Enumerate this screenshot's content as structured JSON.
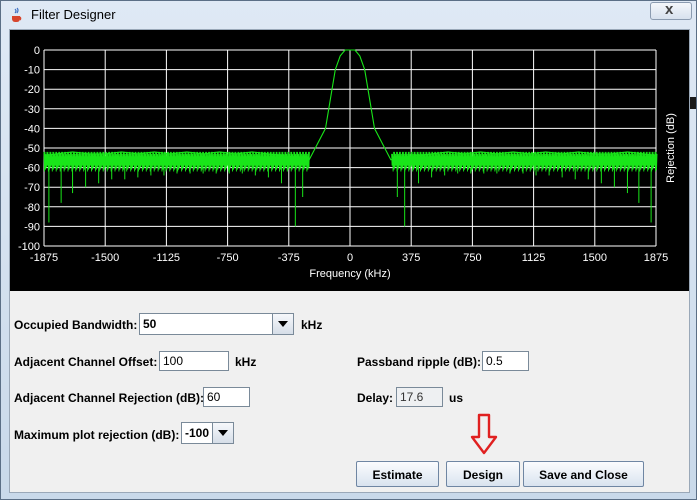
{
  "window": {
    "title": "Filter Designer",
    "close_glyph": "x"
  },
  "chart_data": {
    "type": "line",
    "title": "",
    "xlabel": "Frequency (kHz)",
    "ylabel": "Rejection (dB)",
    "xlim": [
      -1875,
      1875
    ],
    "ylim": [
      -100,
      0
    ],
    "x_ticks": [
      -1875,
      -1500,
      -1125,
      -750,
      -375,
      0,
      375,
      750,
      1125,
      1500,
      1875
    ],
    "y_ticks": [
      0,
      -10,
      -20,
      -30,
      -40,
      -50,
      -60,
      -70,
      -80,
      -90,
      -100
    ],
    "grid": true,
    "background": "#000000",
    "series": [
      {
        "color": "#19e619",
        "points": [
          [
            -1875,
            -54
          ],
          [
            -1800,
            -53
          ],
          [
            -1700,
            -52
          ],
          [
            -1600,
            -53
          ],
          [
            -1500,
            -53
          ],
          [
            -1400,
            -52
          ],
          [
            -1300,
            -53
          ],
          [
            -1200,
            -52
          ],
          [
            -1100,
            -53
          ],
          [
            -1000,
            -52
          ],
          [
            -900,
            -53
          ],
          [
            -800,
            -52
          ],
          [
            -700,
            -53
          ],
          [
            -600,
            -52
          ],
          [
            -500,
            -53
          ],
          [
            -400,
            -54
          ],
          [
            -300,
            -55
          ],
          [
            -250,
            -56
          ],
          [
            -150,
            -40
          ],
          [
            -120,
            -25
          ],
          [
            -90,
            -10
          ],
          [
            -60,
            -3
          ],
          [
            -30,
            0
          ],
          [
            0,
            0
          ],
          [
            30,
            0
          ],
          [
            60,
            -3
          ],
          [
            90,
            -10
          ],
          [
            120,
            -25
          ],
          [
            150,
            -40
          ],
          [
            250,
            -56
          ],
          [
            300,
            -55
          ],
          [
            400,
            -54
          ],
          [
            500,
            -53
          ],
          [
            600,
            -52
          ],
          [
            700,
            -53
          ],
          [
            800,
            -52
          ],
          [
            900,
            -53
          ],
          [
            1000,
            -52
          ],
          [
            1100,
            -53
          ],
          [
            1200,
            -52
          ],
          [
            1300,
            -53
          ],
          [
            1400,
            -52
          ],
          [
            1500,
            -53
          ],
          [
            1600,
            -53
          ],
          [
            1700,
            -52
          ],
          [
            1800,
            -53
          ],
          [
            1875,
            -54
          ]
        ],
        "nulls_db": [
          [
            -1845,
            -88
          ],
          [
            -1770,
            -78
          ],
          [
            -1700,
            -73
          ],
          [
            -1620,
            -70
          ],
          [
            -1540,
            -68
          ],
          [
            -1460,
            -66
          ],
          [
            -1380,
            -66
          ],
          [
            -1300,
            -65
          ],
          [
            -1220,
            -64
          ],
          [
            -1140,
            -64
          ],
          [
            -1060,
            -63
          ],
          [
            -980,
            -63
          ],
          [
            -900,
            -63
          ],
          [
            -820,
            -63
          ],
          [
            -740,
            -63
          ],
          [
            -660,
            -63
          ],
          [
            -580,
            -64
          ],
          [
            -500,
            -65
          ],
          [
            -420,
            -68
          ],
          [
            -335,
            -90
          ],
          [
            -290,
            -75
          ],
          [
            290,
            -75
          ],
          [
            335,
            -90
          ],
          [
            420,
            -68
          ],
          [
            500,
            -65
          ],
          [
            580,
            -64
          ],
          [
            660,
            -63
          ],
          [
            740,
            -63
          ],
          [
            820,
            -63
          ],
          [
            900,
            -63
          ],
          [
            980,
            -63
          ],
          [
            1060,
            -63
          ],
          [
            1140,
            -64
          ],
          [
            1220,
            -64
          ],
          [
            1300,
            -65
          ],
          [
            1380,
            -66
          ],
          [
            1460,
            -66
          ],
          [
            1540,
            -68
          ],
          [
            1620,
            -70
          ],
          [
            1700,
            -73
          ],
          [
            1770,
            -78
          ],
          [
            1845,
            -88
          ]
        ]
      }
    ]
  },
  "form": {
    "occupied_bandwidth": {
      "label": "Occupied Bandwidth:",
      "value": "50",
      "unit": "kHz"
    },
    "adjacent_channel_offset": {
      "label": "Adjacent Channel Offset:",
      "value": "100",
      "unit": "kHz"
    },
    "passband_ripple": {
      "label": "Passband ripple (dB):",
      "value": "0.5"
    },
    "adjacent_channel_rejection": {
      "label": "Adjacent Channel Rejection (dB):",
      "value": "60"
    },
    "delay": {
      "label": "Delay:",
      "value": "17.6",
      "unit": "us"
    },
    "max_plot_rejection": {
      "label": "Maximum plot rejection (dB):",
      "value": "-100"
    }
  },
  "buttons": {
    "estimate": "Estimate",
    "design": "Design",
    "save_close": "Save and Close"
  },
  "colors": {
    "plot_line": "#19e619",
    "grid": "#ffffff",
    "annotation_arrow": "#e02020"
  }
}
